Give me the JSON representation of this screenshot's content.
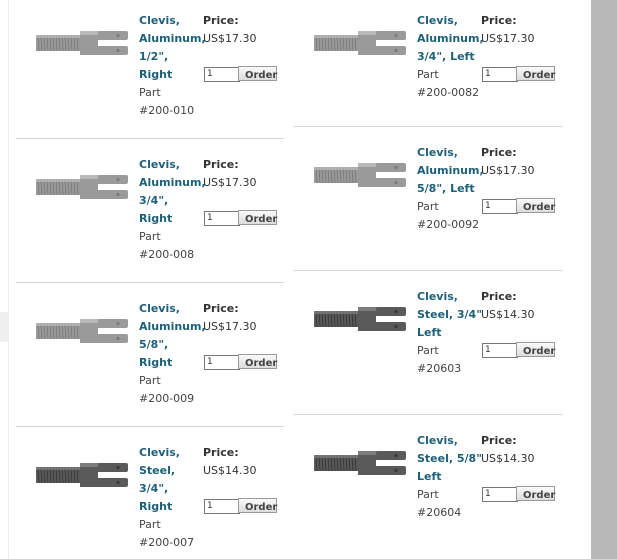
{
  "products": [
    {
      "name_lines": [
        "Clevis,",
        "Aluminum,",
        "1/2\",",
        "Right"
      ],
      "part_lines": [
        "Part",
        "#200-010"
      ],
      "price_label": "Price:",
      "price": "US$17.30",
      "qty": "1",
      "order_label": "Order",
      "material": "aluminum"
    },
    {
      "name_lines": [
        "Clevis,",
        "Aluminum,",
        "3/4\", Left"
      ],
      "part_lines": [
        "Part",
        "#200-0082"
      ],
      "price_label": "Price:",
      "price": "US$17.30",
      "qty": "1",
      "order_label": "Order",
      "material": "aluminum"
    },
    {
      "name_lines": [
        "Clevis,",
        "Aluminum,",
        "3/4\",",
        "Right"
      ],
      "part_lines": [
        "Part",
        "#200-008"
      ],
      "price_label": "Price:",
      "price": "US$17.30",
      "qty": "1",
      "order_label": "Order",
      "material": "aluminum"
    },
    {
      "name_lines": [
        "Clevis,",
        "Aluminum,",
        "5/8\", Left"
      ],
      "part_lines": [
        "Part",
        "#200-0092"
      ],
      "price_label": "Price:",
      "price": "US$17.30",
      "qty": "1",
      "order_label": "Order",
      "material": "aluminum"
    },
    {
      "name_lines": [
        "Clevis,",
        "Aluminum,",
        "5/8\",",
        "Right"
      ],
      "part_lines": [
        "Part",
        "#200-009"
      ],
      "price_label": "Price:",
      "price": "US$17.30",
      "qty": "1",
      "order_label": "Order",
      "material": "aluminum"
    },
    {
      "name_lines": [
        "Clevis,",
        "Steel, 3/4\"",
        "Left"
      ],
      "part_lines": [
        "Part",
        "#20603"
      ],
      "price_label": "Price:",
      "price": "US$14.30",
      "qty": "1",
      "order_label": "Order",
      "material": "steel"
    },
    {
      "name_lines": [
        "Clevis,",
        "Steel,",
        "3/4\",",
        "Right"
      ],
      "part_lines": [
        "Part",
        "#200-007"
      ],
      "price_label": "Price:",
      "price": "US$14.30",
      "qty": "1",
      "order_label": "Order",
      "material": "steel"
    },
    {
      "name_lines": [
        "Clevis,",
        "Steel, 5/8\"",
        "Left"
      ],
      "part_lines": [
        "Part",
        "#20604"
      ],
      "price_label": "Price:",
      "price": "US$14.30",
      "qty": "1",
      "order_label": "Order",
      "material": "steel"
    }
  ],
  "colors": {
    "link": "#1e5f7a",
    "aluminum": "#9a9a9a",
    "steel": "#5a5a5a",
    "scrollbar": "#b9b9b9"
  }
}
